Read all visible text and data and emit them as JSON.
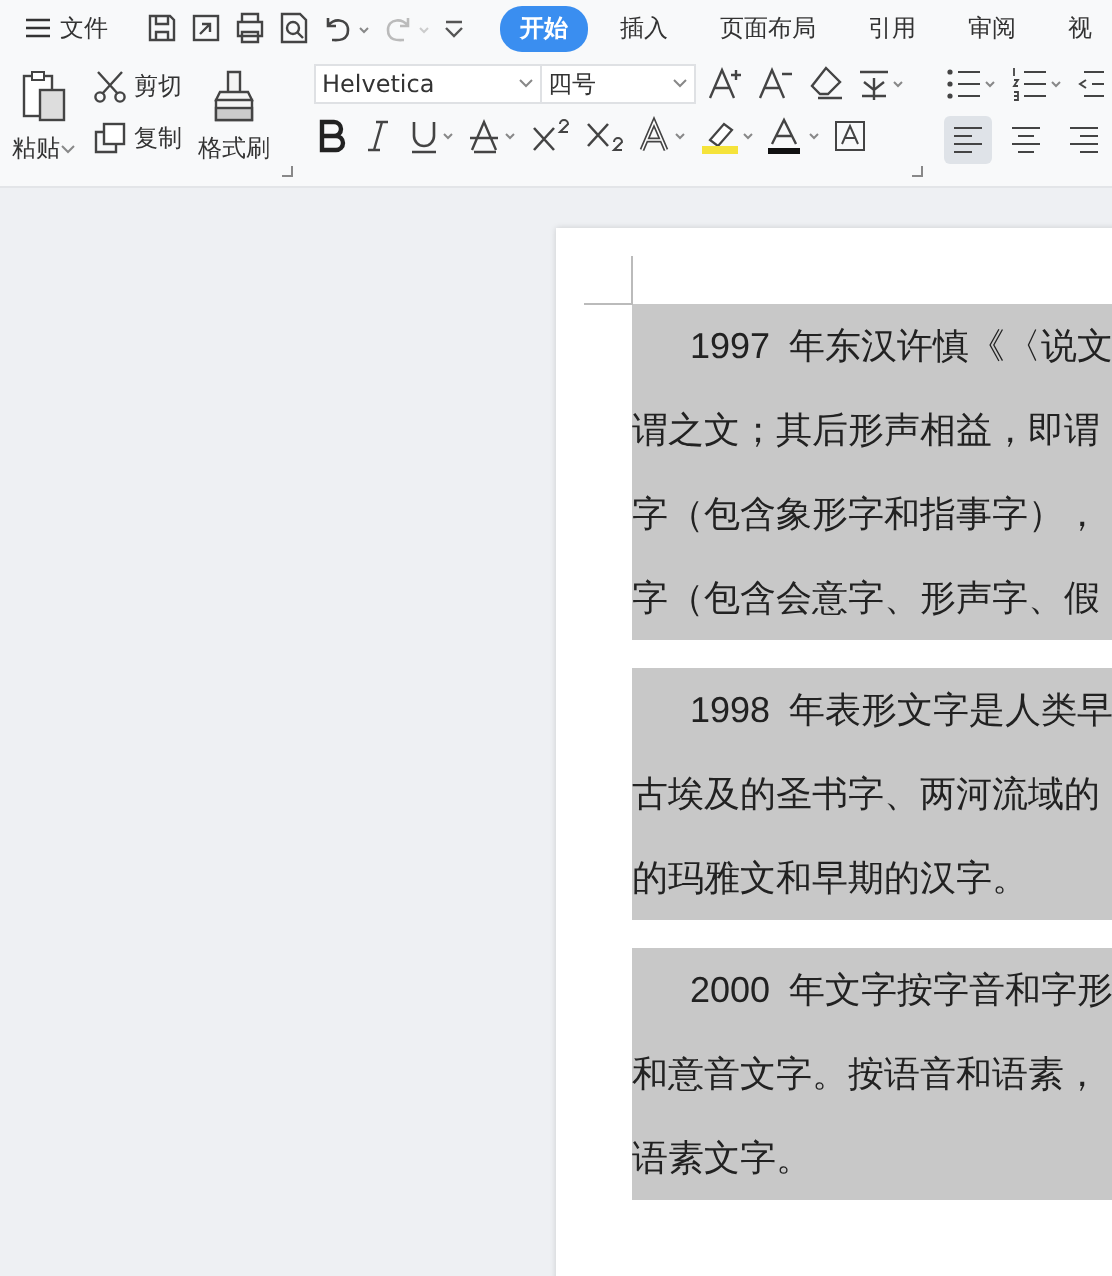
{
  "menu": {
    "label": "文件"
  },
  "tabs": [
    {
      "label": "开始",
      "selected": true
    },
    {
      "label": "插入",
      "selected": false
    },
    {
      "label": "页面布局",
      "selected": false
    },
    {
      "label": "引用",
      "selected": false
    },
    {
      "label": "审阅",
      "selected": false
    },
    {
      "label": "视",
      "selected": false
    }
  ],
  "clipboard": {
    "paste": "粘贴",
    "cut": "剪切",
    "copy": "复制",
    "format_painter": "格式刷"
  },
  "font": {
    "name": "Helvetica",
    "size": "四号"
  },
  "alignment": [
    {
      "kind": "left",
      "selected": true
    },
    {
      "kind": "center",
      "selected": false
    },
    {
      "kind": "right",
      "selected": false
    }
  ],
  "document": {
    "paragraphs": [
      {
        "selected": true,
        "lines": [
          "1997 年东汉许慎《〈说文",
          "谓之文；其后形声相益，即谓",
          "字（包含象形字和指事字），",
          "字（包含会意字、形声字、假"
        ]
      },
      {
        "selected": true,
        "lines": [
          "1998 年表形文字是人类早",
          "古埃及的圣书字、两河流域的",
          "的玛雅文和早期的汉字。"
        ]
      },
      {
        "selected": true,
        "lines": [
          "2000 年文字按字音和字形",
          "和意音文字。按语音和语素，",
          "语素文字。"
        ]
      }
    ]
  }
}
